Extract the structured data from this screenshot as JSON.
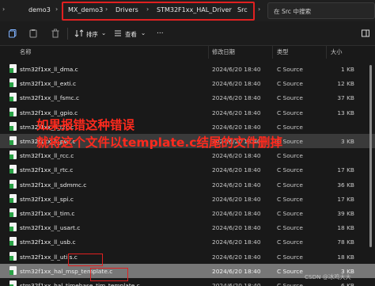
{
  "address_bar": {
    "crumbs": [
      "demo3",
      "MX_demo3",
      "Drivers",
      "STM32F1xx_HAL_Driver",
      "Src"
    ],
    "search_placeholder": "在 Src 中搜索"
  },
  "toolbar": {
    "sort_label": "排序",
    "view_label": "查看",
    "more_label": "..."
  },
  "columns": {
    "name": "名称",
    "date": "修改日期",
    "type": "类型",
    "size": "大小"
  },
  "files": [
    {
      "name": "stm32f1xx_ll_dma.c",
      "date": "2024/6/20 18:40",
      "type": "C Source",
      "size": "1 KB",
      "state": "normal"
    },
    {
      "name": "stm32f1xx_ll_exti.c",
      "date": "2024/6/20 18:40",
      "type": "C Source",
      "size": "12 KB",
      "state": "normal"
    },
    {
      "name": "stm32f1xx_ll_fsmc.c",
      "date": "2024/6/20 18:40",
      "type": "C Source",
      "size": "37 KB",
      "state": "normal"
    },
    {
      "name": "stm32f1xx_ll_gpio.c",
      "date": "2024/6/20 18:40",
      "type": "C Source",
      "size": "13 KB",
      "state": "normal"
    },
    {
      "name": "stm32f1xx_ll_i2c.c",
      "date": "2024/6/20 18:40",
      "type": "C Source",
      "size": "",
      "state": "normal"
    },
    {
      "name": "stm32f1xx_ll_pwr.c",
      "date": "2024/6/20 18:40",
      "type": "C Source",
      "size": "3 KB",
      "state": "dim"
    },
    {
      "name": "stm32f1xx_ll_rcc.c",
      "date": "2024/6/20 18:40",
      "type": "C Source",
      "size": "",
      "state": "normal"
    },
    {
      "name": "stm32f1xx_ll_rtc.c",
      "date": "2024/6/20 18:40",
      "type": "C Source",
      "size": "17 KB",
      "state": "normal"
    },
    {
      "name": "stm32f1xx_ll_sdmmc.c",
      "date": "2024/6/20 18:40",
      "type": "C Source",
      "size": "36 KB",
      "state": "normal"
    },
    {
      "name": "stm32f1xx_ll_spi.c",
      "date": "2024/6/20 18:40",
      "type": "C Source",
      "size": "17 KB",
      "state": "normal"
    },
    {
      "name": "stm32f1xx_ll_tim.c",
      "date": "2024/6/20 18:40",
      "type": "C Source",
      "size": "39 KB",
      "state": "normal"
    },
    {
      "name": "stm32f1xx_ll_usart.c",
      "date": "2024/6/20 18:40",
      "type": "C Source",
      "size": "18 KB",
      "state": "normal"
    },
    {
      "name": "stm32f1xx_ll_usb.c",
      "date": "2024/6/20 18:40",
      "type": "C Source",
      "size": "78 KB",
      "state": "normal"
    },
    {
      "name": "stm32f1xx_ll_utils.c",
      "date": "2024/6/20 18:40",
      "type": "C Source",
      "size": "18 KB",
      "state": "normal"
    },
    {
      "name": "stm32f1xx_hal_msp_template.c",
      "date": "2024/6/20 18:40",
      "type": "C Source",
      "size": "3 KB",
      "state": "selected"
    },
    {
      "name": "stm32f1xx_hal_timebase_tim_template.c",
      "date": "2024/6/20 18:40",
      "type": "C Source",
      "size": "6 KB",
      "state": "normal"
    }
  ],
  "annotation": {
    "line1": "如果报错这种错误",
    "line2": "就将这个文件以template.c结尾的文件删掉"
  },
  "watermark": "CSDN @冰鸡大大",
  "colors": {
    "highlight_red": "#e02020",
    "annotation_red": "#ff2a1e",
    "file_icon_green": "#2aa346"
  }
}
